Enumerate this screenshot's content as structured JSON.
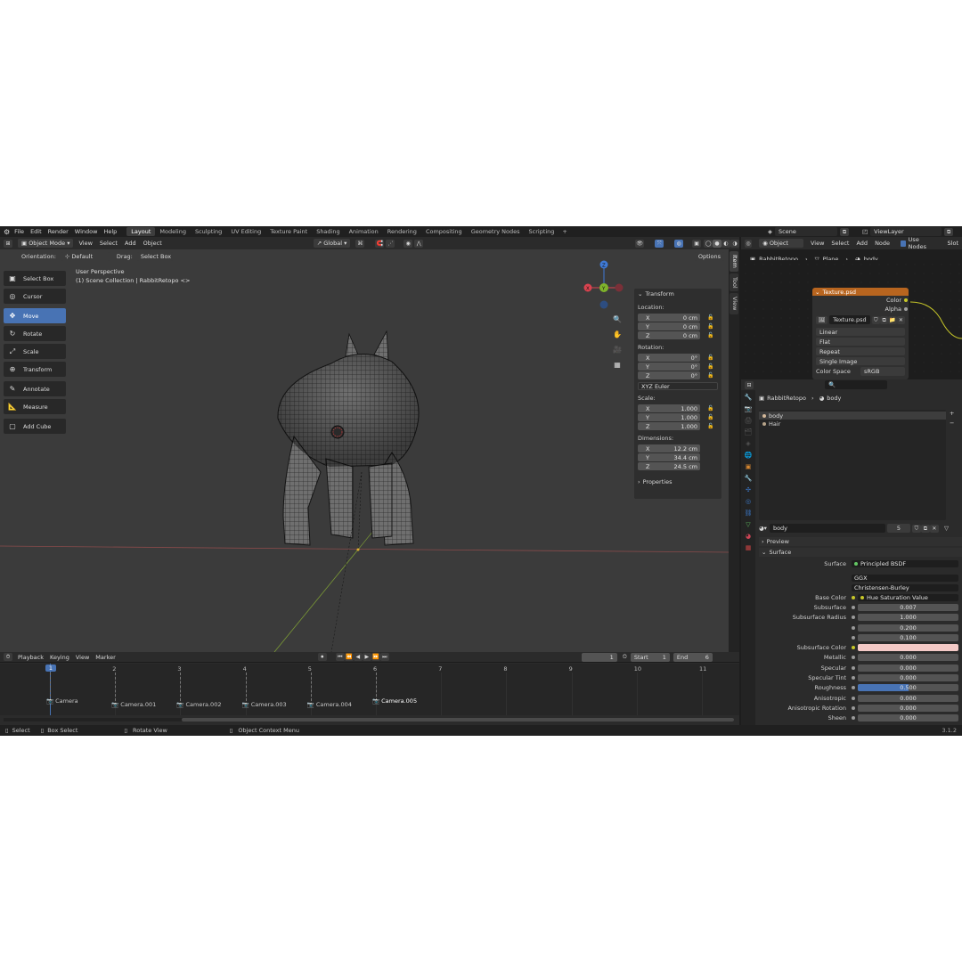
{
  "app": {
    "menus": [
      "File",
      "Edit",
      "Render",
      "Window",
      "Help"
    ],
    "workspaces": [
      "Layout",
      "Modeling",
      "Sculpting",
      "UV Editing",
      "Texture Paint",
      "Shading",
      "Animation",
      "Rendering",
      "Compositing",
      "Geometry Nodes",
      "Scripting"
    ],
    "active_workspace": "Layout",
    "add_tab": "+",
    "scene": "Scene",
    "view_layer": "ViewLayer",
    "version": "3.1.2"
  },
  "viewport_header": {
    "mode": "Object Mode",
    "menus": [
      "View",
      "Select",
      "Add",
      "Object"
    ],
    "transform_space": "Global",
    "orientation_label": "Orientation:",
    "orientation_value": "Default",
    "drag_label": "Drag:",
    "drag_value": "Select Box",
    "options": "Options"
  },
  "viewport": {
    "perspective": "User Perspective",
    "collection": "(1) Scene Collection | RabbitRetopo <>",
    "gizmo": {
      "x": "X",
      "y": "Y",
      "z": "Z"
    }
  },
  "toolbar": {
    "tools": [
      {
        "label": "Select Box",
        "icon": "▣"
      },
      {
        "label": "Cursor",
        "icon": "◎"
      },
      {
        "label": "Move",
        "icon": "✥"
      },
      {
        "label": "Rotate",
        "icon": "↻"
      },
      {
        "label": "Scale",
        "icon": "⤢"
      },
      {
        "label": "Transform",
        "icon": "⊕"
      },
      {
        "label": "Annotate",
        "icon": "✎"
      },
      {
        "label": "Measure",
        "icon": "📐"
      },
      {
        "label": "Add Cube",
        "icon": "▢"
      }
    ],
    "active": "Move"
  },
  "npanel": {
    "title": "Transform",
    "location_label": "Location:",
    "location": [
      {
        "axis": "X",
        "value": "0 cm"
      },
      {
        "axis": "Y",
        "value": "0 cm"
      },
      {
        "axis": "Z",
        "value": "0 cm"
      }
    ],
    "rotation_label": "Rotation:",
    "rotation": [
      {
        "axis": "X",
        "value": "0°"
      },
      {
        "axis": "Y",
        "value": "0°"
      },
      {
        "axis": "Z",
        "value": "0°"
      }
    ],
    "rotation_mode": "XYZ Euler",
    "scale_label": "Scale:",
    "scale": [
      {
        "axis": "X",
        "value": "1.000"
      },
      {
        "axis": "Y",
        "value": "1.000"
      },
      {
        "axis": "Z",
        "value": "1.000"
      }
    ],
    "dimensions_label": "Dimensions:",
    "dimensions": [
      {
        "axis": "X",
        "value": "12.2 cm"
      },
      {
        "axis": "Y",
        "value": "34.4 cm"
      },
      {
        "axis": "Z",
        "value": "24.5 cm"
      }
    ],
    "properties": "Properties",
    "side_tabs": [
      "Item",
      "Tool",
      "View"
    ]
  },
  "timeline": {
    "menus": [
      "Playback",
      "Keying",
      "View",
      "Marker"
    ],
    "current_frame": "1",
    "start_label": "Start",
    "start": "1",
    "end_label": "End",
    "end": "6",
    "frames": [
      "1",
      "2",
      "3",
      "4",
      "5",
      "6",
      "7",
      "8",
      "9",
      "10",
      "11"
    ],
    "markers": [
      "Camera",
      "Camera.001",
      "Camera.002",
      "Camera.003",
      "Camera.004",
      "Camera.005"
    ]
  },
  "status": {
    "select": "Select",
    "box_select": "Box Select",
    "rotate_view": "Rotate View",
    "context_menu": "Object Context Menu"
  },
  "node_editor": {
    "object_btn": "Object",
    "menus": [
      "View",
      "Select",
      "Add",
      "Node"
    ],
    "use_nodes": "Use Nodes",
    "slot": "Slot",
    "breadcrumb": [
      "RabbitRetopo",
      "Plane",
      "body"
    ],
    "node": {
      "title": "Texture.psd",
      "outputs": [
        "Color",
        "Alpha"
      ],
      "image": "Texture.psd",
      "interpolation": "Linear",
      "projection": "Flat",
      "extension": "Repeat",
      "source": "Single Image",
      "color_space_label": "Color Space",
      "color_space": "sRGB"
    }
  },
  "properties": {
    "breadcrumb": [
      "RabbitRetopo",
      "body"
    ],
    "slots": [
      "body",
      "Hair"
    ],
    "material_name": "body",
    "material_users": "5",
    "preview": "Preview",
    "surface_section": "Surface",
    "surface_label": "Surface",
    "surface_value": "Principled BSDF",
    "distribution": "GGX",
    "subsurface_method": "Christensen-Burley",
    "fields": [
      {
        "label": "Base Color",
        "value": "Hue Saturation Value",
        "kind": "link"
      },
      {
        "label": "Subsurface",
        "value": "0.007",
        "kind": "num"
      },
      {
        "label": "Subsurface Radius",
        "value": "1.000",
        "kind": "num"
      },
      {
        "label": "",
        "value": "0.200",
        "kind": "num"
      },
      {
        "label": "",
        "value": "0.100",
        "kind": "num"
      },
      {
        "label": "Subsurface Color",
        "value": "",
        "kind": "color"
      },
      {
        "label": "Metallic",
        "value": "0.000",
        "kind": "num"
      },
      {
        "label": "Specular",
        "value": "0.000",
        "kind": "num"
      },
      {
        "label": "Specular Tint",
        "value": "0.000",
        "kind": "num"
      },
      {
        "label": "Roughness",
        "value": "0.500",
        "kind": "slider",
        "fill": 0.5
      },
      {
        "label": "Anisotropic",
        "value": "0.000",
        "kind": "num"
      },
      {
        "label": "Anisotropic Rotation",
        "value": "0.000",
        "kind": "num"
      },
      {
        "label": "Sheen",
        "value": "0.000",
        "kind": "num"
      }
    ]
  },
  "colors": {
    "accent": "#4873b4",
    "node_header": "#b8651f",
    "subsurface_color": "#f3c9c6",
    "x_axis": "#d9434f",
    "y_axis": "#7fb32b",
    "z_axis": "#3f7ad6"
  }
}
